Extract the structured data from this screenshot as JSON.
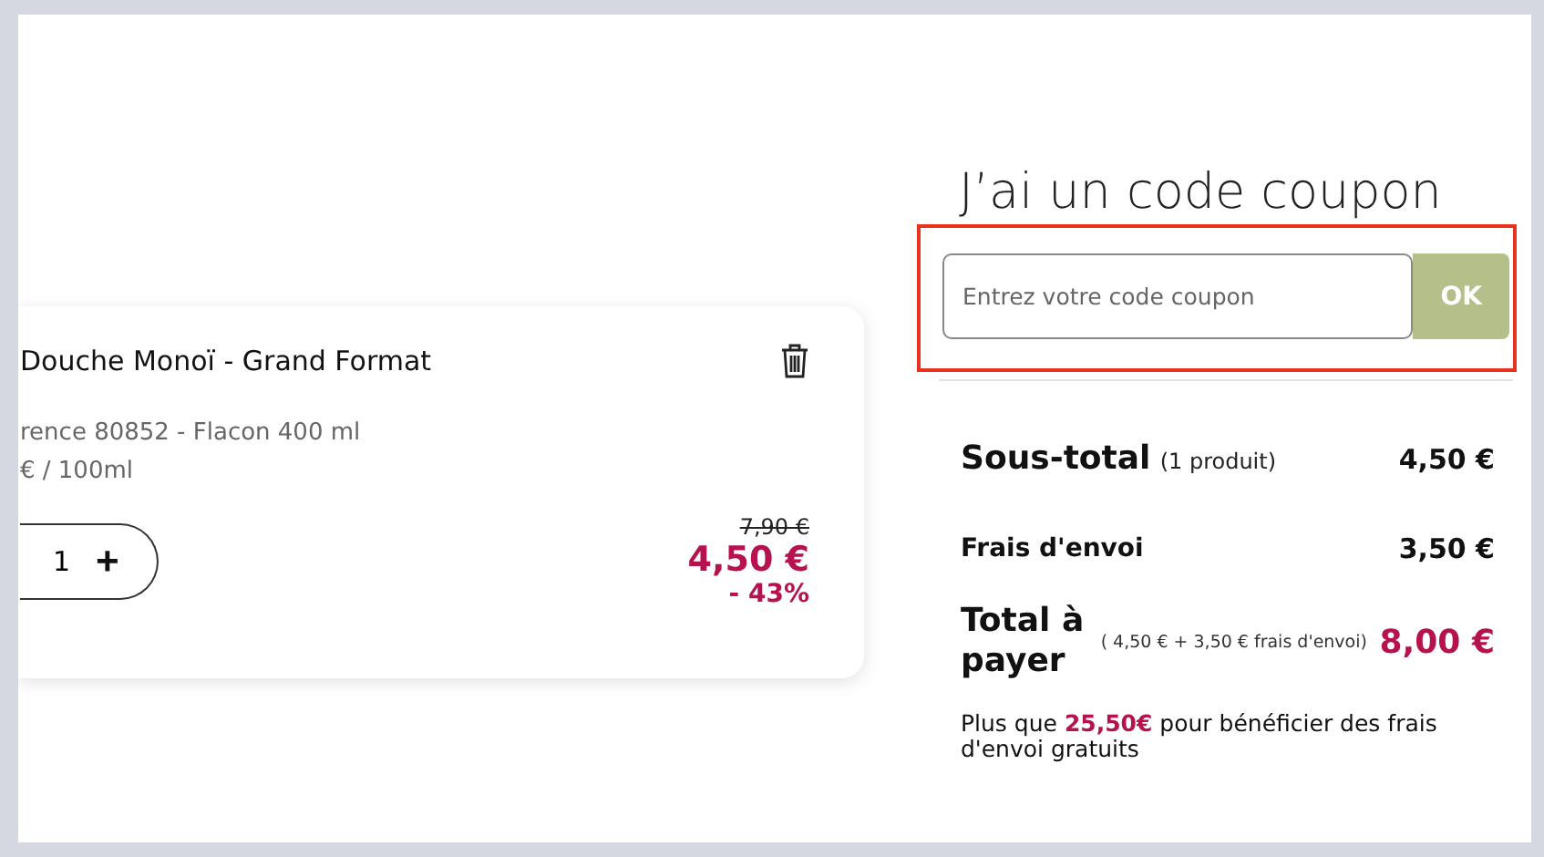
{
  "cart_item": {
    "name": "Douche Monoï - Grand Format",
    "reference": "rence 80852 - Flacon 400 ml",
    "unit_price": "€ / 100ml",
    "quantity": "1",
    "increase": "+",
    "old_price": "7,90 €",
    "price": "4,50 €",
    "discount": "- 43%"
  },
  "coupon": {
    "title": "J’ai un code coupon",
    "placeholder": "Entrez votre code coupon",
    "button": "OK",
    "highlighted": true
  },
  "summary": {
    "subtotal_label": "Sous-total",
    "subtotal_count": "(1 produit)",
    "subtotal_value": "4,50 €",
    "shipping_label": "Frais d'envoi",
    "shipping_value": "3,50 €",
    "total_label": "Total à payer",
    "total_detail": "( 4,50 € + 3,50 € frais d'envoi)",
    "total_value": "8,00 €",
    "free_shipping_note": "Plus que **25,50€** pour bénéficier des frais d'envoi gratuits"
  }
}
